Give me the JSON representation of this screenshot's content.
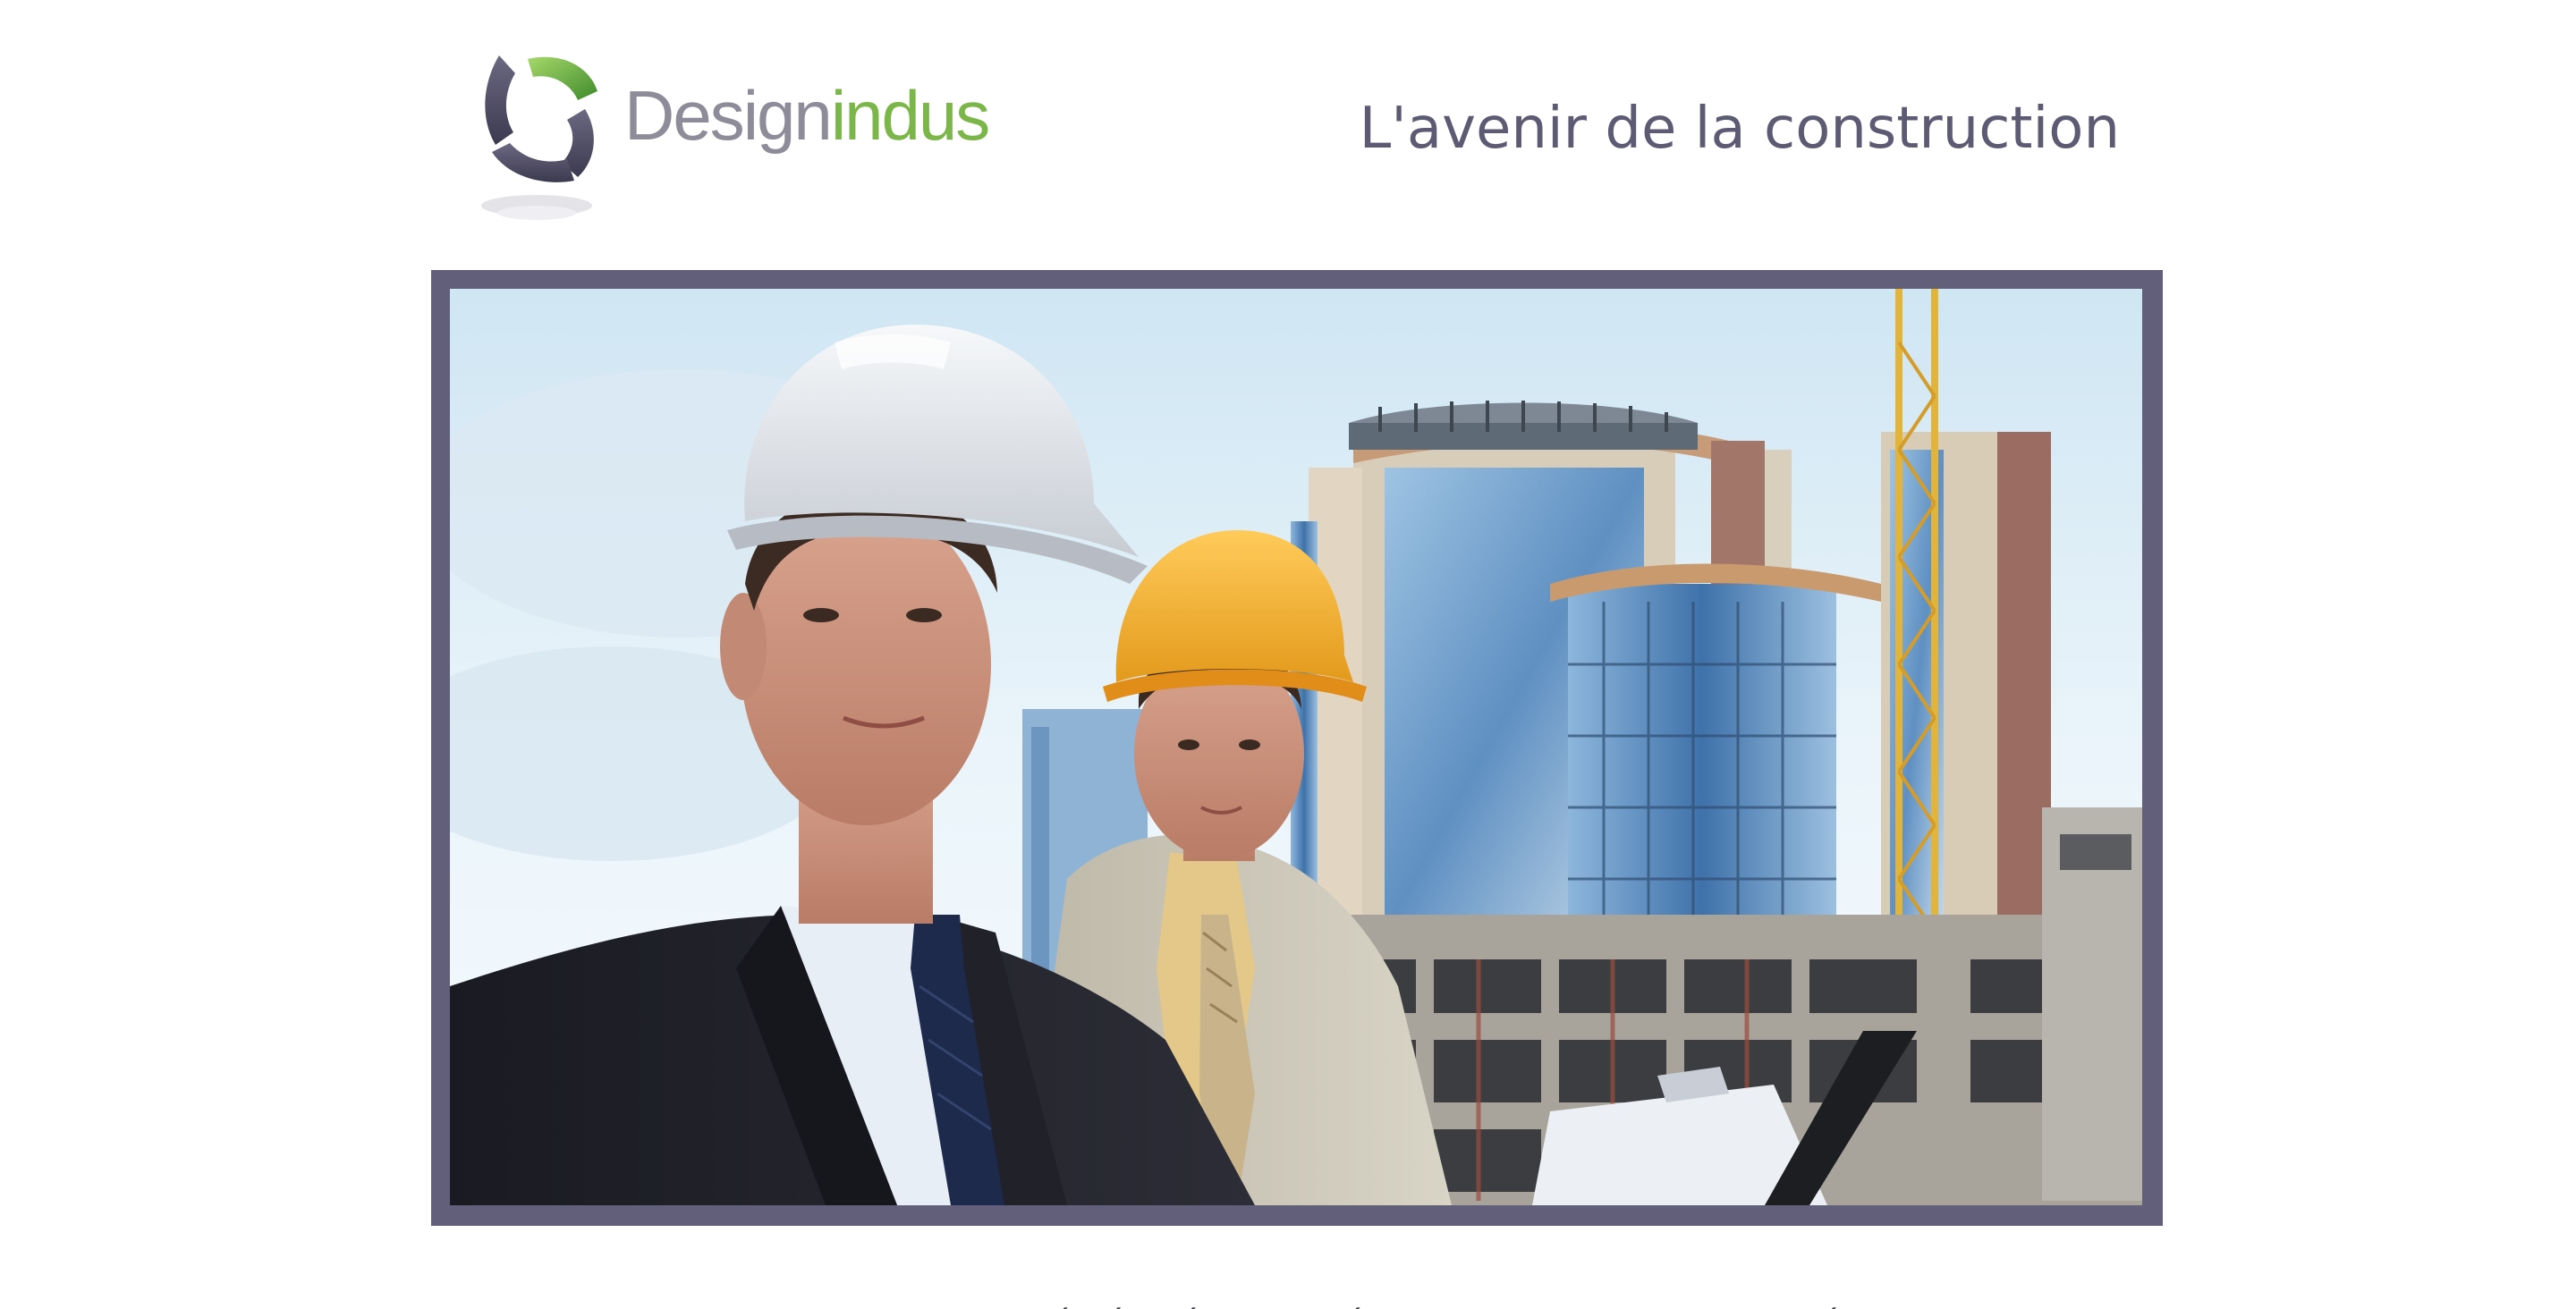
{
  "header": {
    "logo": {
      "name_part_a": "Design",
      "name_part_b": "indus"
    },
    "tagline": "L'avenir de la construction"
  },
  "hero": {
    "image_icon": "construction-engineers-photo"
  },
  "intro": {
    "text": "Le design industriel est une activité géométrique créatrice dont le but est de présenter les multiples facettes de la"
  },
  "colors": {
    "frame": "#625f7a",
    "tagline": "#5d5a74",
    "logo_grey": "#8e8c98",
    "logo_green": "#7bb648"
  }
}
